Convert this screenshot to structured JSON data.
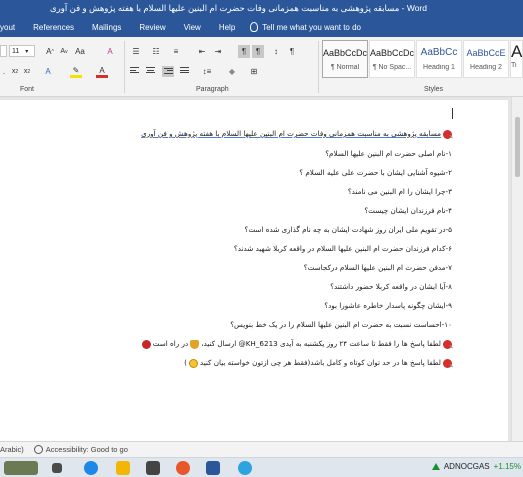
{
  "window": {
    "title": "مسابقه پژوهشی به مناسبت همزمانی وفات حضرت ام البنین علیها السلام با هفته پژوهش و فن آوری - Word"
  },
  "menu": {
    "items": [
      "yout",
      "References",
      "Mailings",
      "Review",
      "View",
      "Help"
    ],
    "tell_me": "Tell me what you want to do"
  },
  "ribbon": {
    "font_size": "11",
    "font_group_label": "Font",
    "paragraph_group_label": "Paragraph",
    "styles_group_label": "Styles",
    "styles": [
      {
        "sample": "AaBbCcDc",
        "name": "¶ Normal"
      },
      {
        "sample": "AaBbCcDc",
        "name": "¶ No Spac..."
      },
      {
        "sample": "AaBbCc",
        "name": "Heading 1"
      },
      {
        "sample": "AaBbCcE",
        "name": "Heading 2"
      },
      {
        "sample": "Aa",
        "name": "Ti"
      }
    ]
  },
  "document": {
    "lines": [
      "مسابقه پژوهشی به مناسبت همزمانی وفات حضرت ام البنین علیها السلام با هفته پژوهش و فن آوری",
      "۱-نام اصلی حضرت ام البنین علیها السلام؟",
      "۲-شیوه آشنایی ایشان با حضرت علی علیه السلام ؟",
      "۳-چرا ایشان را ام البنین می نامند؟",
      "۴-نام فرزندان ایشان چیست؟",
      "۵-در تقویم ملی ایران روز شهادت ایشان به چه نام گذاری شده است؟",
      "۶-کدام فرزندان حضرت ام البنین علیها السلام در واقعه کربلا شهید شدند؟",
      "۷-مدفن حضرت ام البنین علیها السلام درکجاست؟",
      "۸-آیا ایشان در واقعه کربلا حضور داشتند؟",
      "۹-ایشان چگونه پاسدار خاطره عاشورا بود؟",
      "۱۰-احساست نسبت به حضرت ام البنین علیها السلام را در یک خط بنویس؟",
      "لطفا پاسخ ها را فقط تا ساعت ۲۴ روز یکشنبه به آیدی KH_6213@ ارسال کنید،",
      "در راه است",
      "لطفا پاسخ ها در حد توان کوتاه و کامل باشد(فقط هر چی ازتون خواسته بیان کنید",
      ")"
    ]
  },
  "statusbar": {
    "language": "Arabic)",
    "accessibility": "Accessibility: Good to go"
  },
  "taskbar": {
    "stock_symbol": "ADNOCGAS",
    "stock_change": "+1.15%"
  }
}
